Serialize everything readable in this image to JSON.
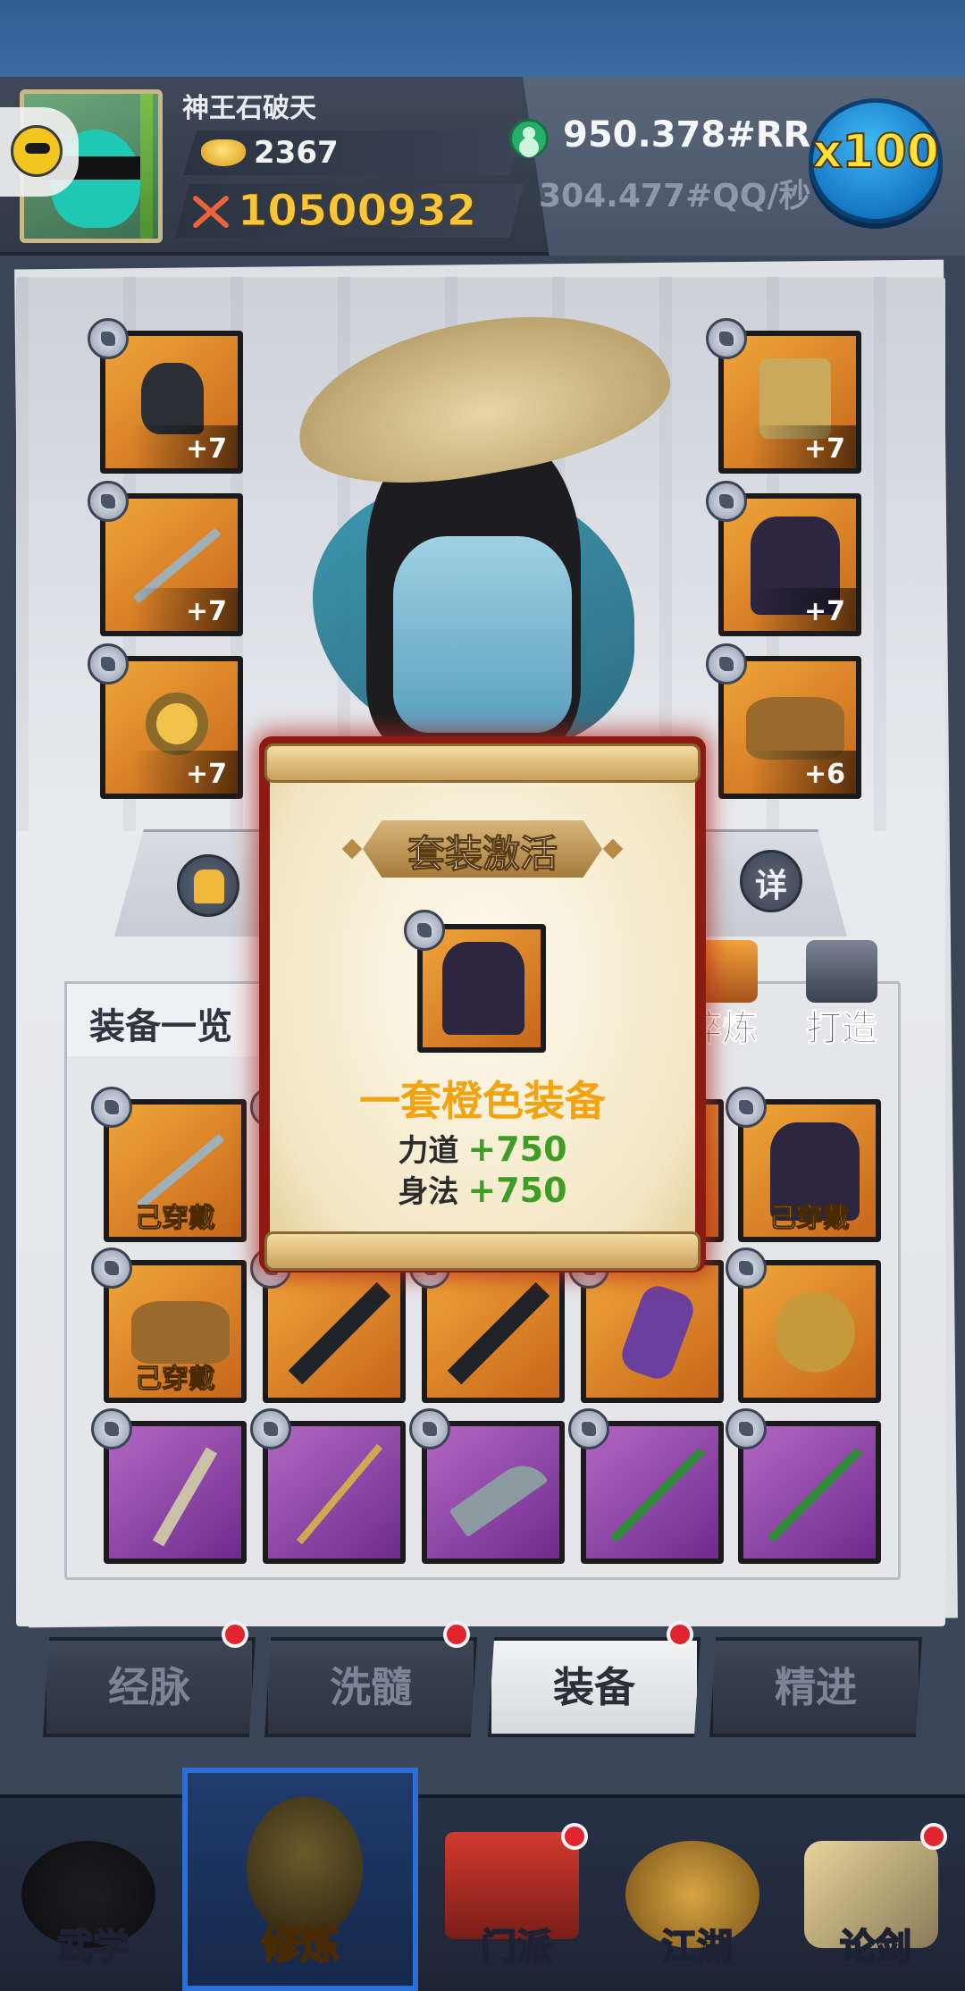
{
  "player": {
    "name": "神王石破天",
    "gold": "2367",
    "power": "10500932"
  },
  "resources": {
    "primary": "950.378#RR",
    "rate": "304.477#QQ/秒",
    "multiplier": "x100"
  },
  "equipped": {
    "left": [
      {
        "item": "helmet",
        "level": "+7",
        "rarity": "orange"
      },
      {
        "item": "sword",
        "level": "+7",
        "rarity": "orange"
      },
      {
        "item": "ring",
        "level": "+7",
        "rarity": "orange"
      }
    ],
    "right": [
      {
        "item": "belt",
        "level": "+7",
        "rarity": "orange"
      },
      {
        "item": "armor",
        "level": "+7",
        "rarity": "orange"
      },
      {
        "item": "boots",
        "level": "+6",
        "rarity": "orange"
      }
    ]
  },
  "actions": {
    "detail_label": "详"
  },
  "equipment_list": {
    "title": "装备一览",
    "tools": [
      {
        "label": "淬炼",
        "icon": "furnace-icon"
      },
      {
        "label": "打造",
        "icon": "anvil-icon"
      }
    ],
    "worn_label": "己穿戴",
    "rows": [
      [
        {
          "item": "sword",
          "rarity": "orange",
          "worn": true
        },
        {
          "item": "hidden",
          "rarity": "orange",
          "worn": false
        },
        {
          "item": "hidden",
          "rarity": "orange",
          "worn": false
        },
        {
          "item": "hidden",
          "rarity": "orange",
          "worn": true
        },
        {
          "item": "armor",
          "rarity": "orange",
          "worn": true
        }
      ],
      [
        {
          "item": "boots",
          "rarity": "orange",
          "worn": true
        },
        {
          "item": "greatsword",
          "rarity": "orange",
          "worn": false
        },
        {
          "item": "greatsword",
          "rarity": "orange",
          "worn": false
        },
        {
          "item": "bracer",
          "rarity": "orange",
          "worn": false
        },
        {
          "item": "dragon-ring",
          "rarity": "orange",
          "worn": false
        }
      ],
      [
        {
          "item": "dagger",
          "rarity": "purple",
          "worn": false
        },
        {
          "item": "staff",
          "rarity": "purple",
          "worn": false
        },
        {
          "item": "blade",
          "rarity": "purple",
          "worn": false
        },
        {
          "item": "flute",
          "rarity": "purple",
          "worn": false
        },
        {
          "item": "flute",
          "rarity": "purple",
          "worn": false
        }
      ]
    ]
  },
  "sub_tabs": [
    {
      "label": "经脉",
      "active": false,
      "dot": true
    },
    {
      "label": "洗髓",
      "active": false,
      "dot": true
    },
    {
      "label": "装备",
      "active": true,
      "dot": true
    },
    {
      "label": "精进",
      "active": false,
      "dot": false
    }
  ],
  "bottom_nav": [
    {
      "label": "武学",
      "active": false,
      "dot": false
    },
    {
      "label": "修炼",
      "active": true,
      "dot": false
    },
    {
      "label": "门派",
      "active": false,
      "dot": true
    },
    {
      "label": "江湖",
      "active": false,
      "dot": false
    },
    {
      "label": "论剑",
      "active": false,
      "dot": true
    }
  ],
  "modal": {
    "title": "套装激活",
    "set_name": "一套橙色装备",
    "attributes": [
      {
        "name": "力道",
        "value": "+750"
      },
      {
        "name": "身法",
        "value": "+750"
      }
    ]
  },
  "colors": {
    "orange_rarity": "#e08a2a",
    "purple_rarity": "#8f45a8",
    "power": "#f6c63c",
    "bonus": "#3f9c25",
    "set_name": "#f2a30f",
    "active_nav": "#2c6fd8",
    "red_dot": "#e2242e"
  }
}
